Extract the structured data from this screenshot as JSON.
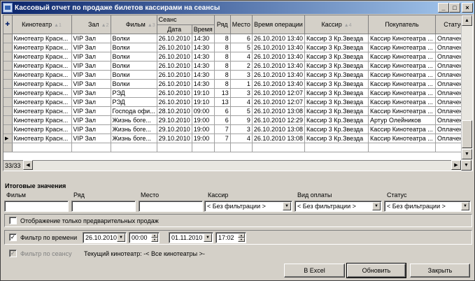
{
  "window": {
    "title": "Кассовый отчет по продаже билетов кассирами на сеансы"
  },
  "titlebar": {
    "minimize": "_",
    "maximize": "□",
    "close": "×"
  },
  "grid": {
    "headers": {
      "cinema": "Кинотеатр",
      "hall": "Зал",
      "film": "Фильм",
      "session": "Сеанс",
      "date": "Дата",
      "time": "Время",
      "row": "Ряд",
      "seat": "Место",
      "op_time": "Время операции",
      "cashier": "Кассир",
      "buyer": "Покупатель",
      "status": "Статус"
    },
    "sort_marks": {
      "cinema": "1",
      "hall": "2",
      "film": "3",
      "cashier": "4"
    },
    "rows": [
      {
        "cinema": "Кинотеатр Красн...",
        "hall": "VIP Зал",
        "film": "Волки",
        "date": "26.10.2010",
        "time": "14:30",
        "row": "8",
        "seat": "6",
        "op_time": "26.10.2010 13:40",
        "cashier": "Кассир 3 Кр.Звезда",
        "buyer": "Кассир Кинотеатра ...",
        "status": "Оплачен"
      },
      {
        "cinema": "Кинотеатр Красн...",
        "hall": "VIP Зал",
        "film": "Волки",
        "date": "26.10.2010",
        "time": "14:30",
        "row": "8",
        "seat": "5",
        "op_time": "26.10.2010 13:40",
        "cashier": "Кассир 3 Кр.Звезда",
        "buyer": "Кассир Кинотеатра ...",
        "status": "Оплачен"
      },
      {
        "cinema": "Кинотеатр Красн...",
        "hall": "VIP Зал",
        "film": "Волки",
        "date": "26.10.2010",
        "time": "14:30",
        "row": "8",
        "seat": "4",
        "op_time": "26.10.2010 13:40",
        "cashier": "Кассир 3 Кр.Звезда",
        "buyer": "Кассир Кинотеатра ...",
        "status": "Оплачен"
      },
      {
        "cinema": "Кинотеатр Красн...",
        "hall": "VIP Зал",
        "film": "Волки",
        "date": "26.10.2010",
        "time": "14:30",
        "row": "8",
        "seat": "2",
        "op_time": "26.10.2010 13:40",
        "cashier": "Кассир 3 Кр.Звезда",
        "buyer": "Кассир Кинотеатра ...",
        "status": "Оплачен"
      },
      {
        "cinema": "Кинотеатр Красн...",
        "hall": "VIP Зал",
        "film": "Волки",
        "date": "26.10.2010",
        "time": "14:30",
        "row": "8",
        "seat": "3",
        "op_time": "26.10.2010 13:40",
        "cashier": "Кассир 3 Кр.Звезда",
        "buyer": "Кассир Кинотеатра ...",
        "status": "Оплачен"
      },
      {
        "cinema": "Кинотеатр Красн...",
        "hall": "VIP Зал",
        "film": "Волки",
        "date": "26.10.2010",
        "time": "14:30",
        "row": "8",
        "seat": "1",
        "op_time": "26.10.2010 13:40",
        "cashier": "Кассир 3 Кр.Звезда",
        "buyer": "Кассир Кинотеатра ...",
        "status": "Оплачен"
      },
      {
        "cinema": "Кинотеатр Красн...",
        "hall": "VIP Зал",
        "film": "РЭД",
        "date": "26.10.2010",
        "time": "19:10",
        "row": "13",
        "seat": "3",
        "op_time": "26.10.2010 12:07",
        "cashier": "Кассир 3 Кр.Звезда",
        "buyer": "Кассир Кинотеатра ...",
        "status": "Оплачен"
      },
      {
        "cinema": "Кинотеатр Красн...",
        "hall": "VIP Зал",
        "film": "РЭД",
        "date": "26.10.2010",
        "time": "19:10",
        "row": "13",
        "seat": "4",
        "op_time": "26.10.2010 12:07",
        "cashier": "Кассир 3 Кр.Звезда",
        "buyer": "Кассир Кинотеатра ...",
        "status": "Оплачен"
      },
      {
        "cinema": "Кинотеатр Красн...",
        "hall": "VIP Зал",
        "film": "Господа офи...",
        "date": "28.10.2010",
        "time": "09:00",
        "row": "6",
        "seat": "5",
        "op_time": "26.10.2010 13:08",
        "cashier": "Кассир 3 Кр.Звезда",
        "buyer": "Кассир Кинотеатра ...",
        "status": "Оплачен"
      },
      {
        "cinema": "Кинотеатр Красн...",
        "hall": "VIP Зал",
        "film": "Жизнь боге...",
        "date": "29.10.2010",
        "time": "19:00",
        "row": "6",
        "seat": "9",
        "op_time": "26.10.2010 12:29",
        "cashier": "Кассир 3 Кр.Звезда",
        "buyer": "Артур Олейников",
        "status": "Оплачен"
      },
      {
        "cinema": "Кинотеатр Красн...",
        "hall": "VIP Зал",
        "film": "Жизнь боге...",
        "date": "29.10.2010",
        "time": "19:00",
        "row": "7",
        "seat": "3",
        "op_time": "26.10.2010 13:08",
        "cashier": "Кассир 3 Кр.Звезда",
        "buyer": "Кассир Кинотеатра ...",
        "status": "Оплачен"
      },
      {
        "cinema": "Кинотеатр Красн...",
        "hall": "VIP Зал",
        "film": "Жизнь боге...",
        "date": "29.10.2010",
        "time": "19:00",
        "row": "7",
        "seat": "4",
        "op_time": "26.10.2010 13:08",
        "cashier": "Кассир 3 Кр.Звезда",
        "buyer": "Кассир Кинотеатра ...",
        "status": "Оплачен"
      }
    ],
    "counter": "33/33"
  },
  "totals": {
    "title": "Итоговые значения",
    "film_label": "Фильм",
    "row_label": "Ряд",
    "seat_label": "Место",
    "cashier_label": "Кассир",
    "payment_label": "Вид оплаты",
    "status_label": "Статус",
    "cashier_value": "< Без фильтрации >",
    "payment_value": "< Без фильтрации >",
    "status_value": "< Без фильтрации >"
  },
  "options": {
    "only_presale": "Отображение только предварительных продаж",
    "time_filter": "Фильтр по времени",
    "date_from": "26.10.2010",
    "time_from": "00:00",
    "date_to": "01.11.2010",
    "time_to": "17:02",
    "session_filter": "Фильтр по сеансу",
    "current_cinema": "Текущий кинотеатр: -< Все кинотеатры >-"
  },
  "buttons": {
    "excel": "В Excel",
    "refresh": "Обновить",
    "close": "Закрыть"
  }
}
